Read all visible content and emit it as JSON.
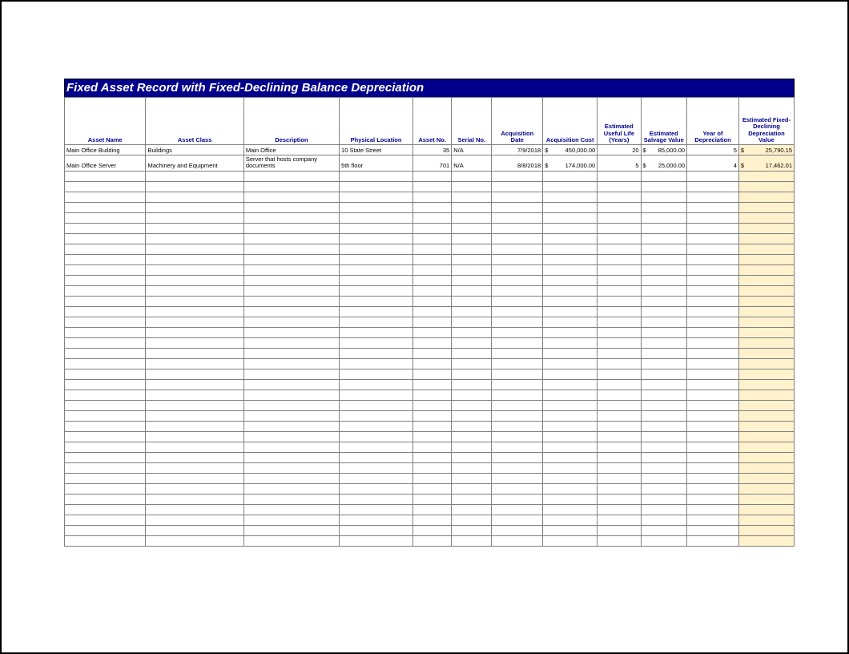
{
  "title": "Fixed Asset Record with Fixed-Declining Balance Depreciation",
  "columns": [
    "Asset Name",
    "Asset Class",
    "Description",
    "Physical Location",
    "Asset No.",
    "Serial No.",
    "Acquisition Date",
    "Acquisition Cost",
    "Estimated Useful Life (Years)",
    "Estimated Salvage Value",
    "Year of Depreciation",
    "Estimated Fixed-Declining Depreciation Value"
  ],
  "rows": [
    {
      "asset_name": "Main Office Building",
      "asset_class": "Buildings",
      "description": "Main Office",
      "location": "10 State Street",
      "asset_no": "35",
      "serial_no": "N/A",
      "acq_date": "7/9/2018",
      "acq_cost": "450,000.00",
      "useful_life": "20",
      "salvage": "85,000.00",
      "year_dep": "5",
      "dep_value": "25,790.15"
    },
    {
      "asset_name": "Main Office Server",
      "asset_class": "Machinery and Equipment",
      "description": "Server that hosts company documents",
      "location": "5th floor",
      "asset_no": "701",
      "serial_no": "N/A",
      "acq_date": "8/8/2018",
      "acq_cost": "174,000.00",
      "useful_life": "5",
      "salvage": "25,000.00",
      "year_dep": "4",
      "dep_value": "17,462.01"
    }
  ],
  "empty_rows": 36,
  "currency_symbol": "$"
}
